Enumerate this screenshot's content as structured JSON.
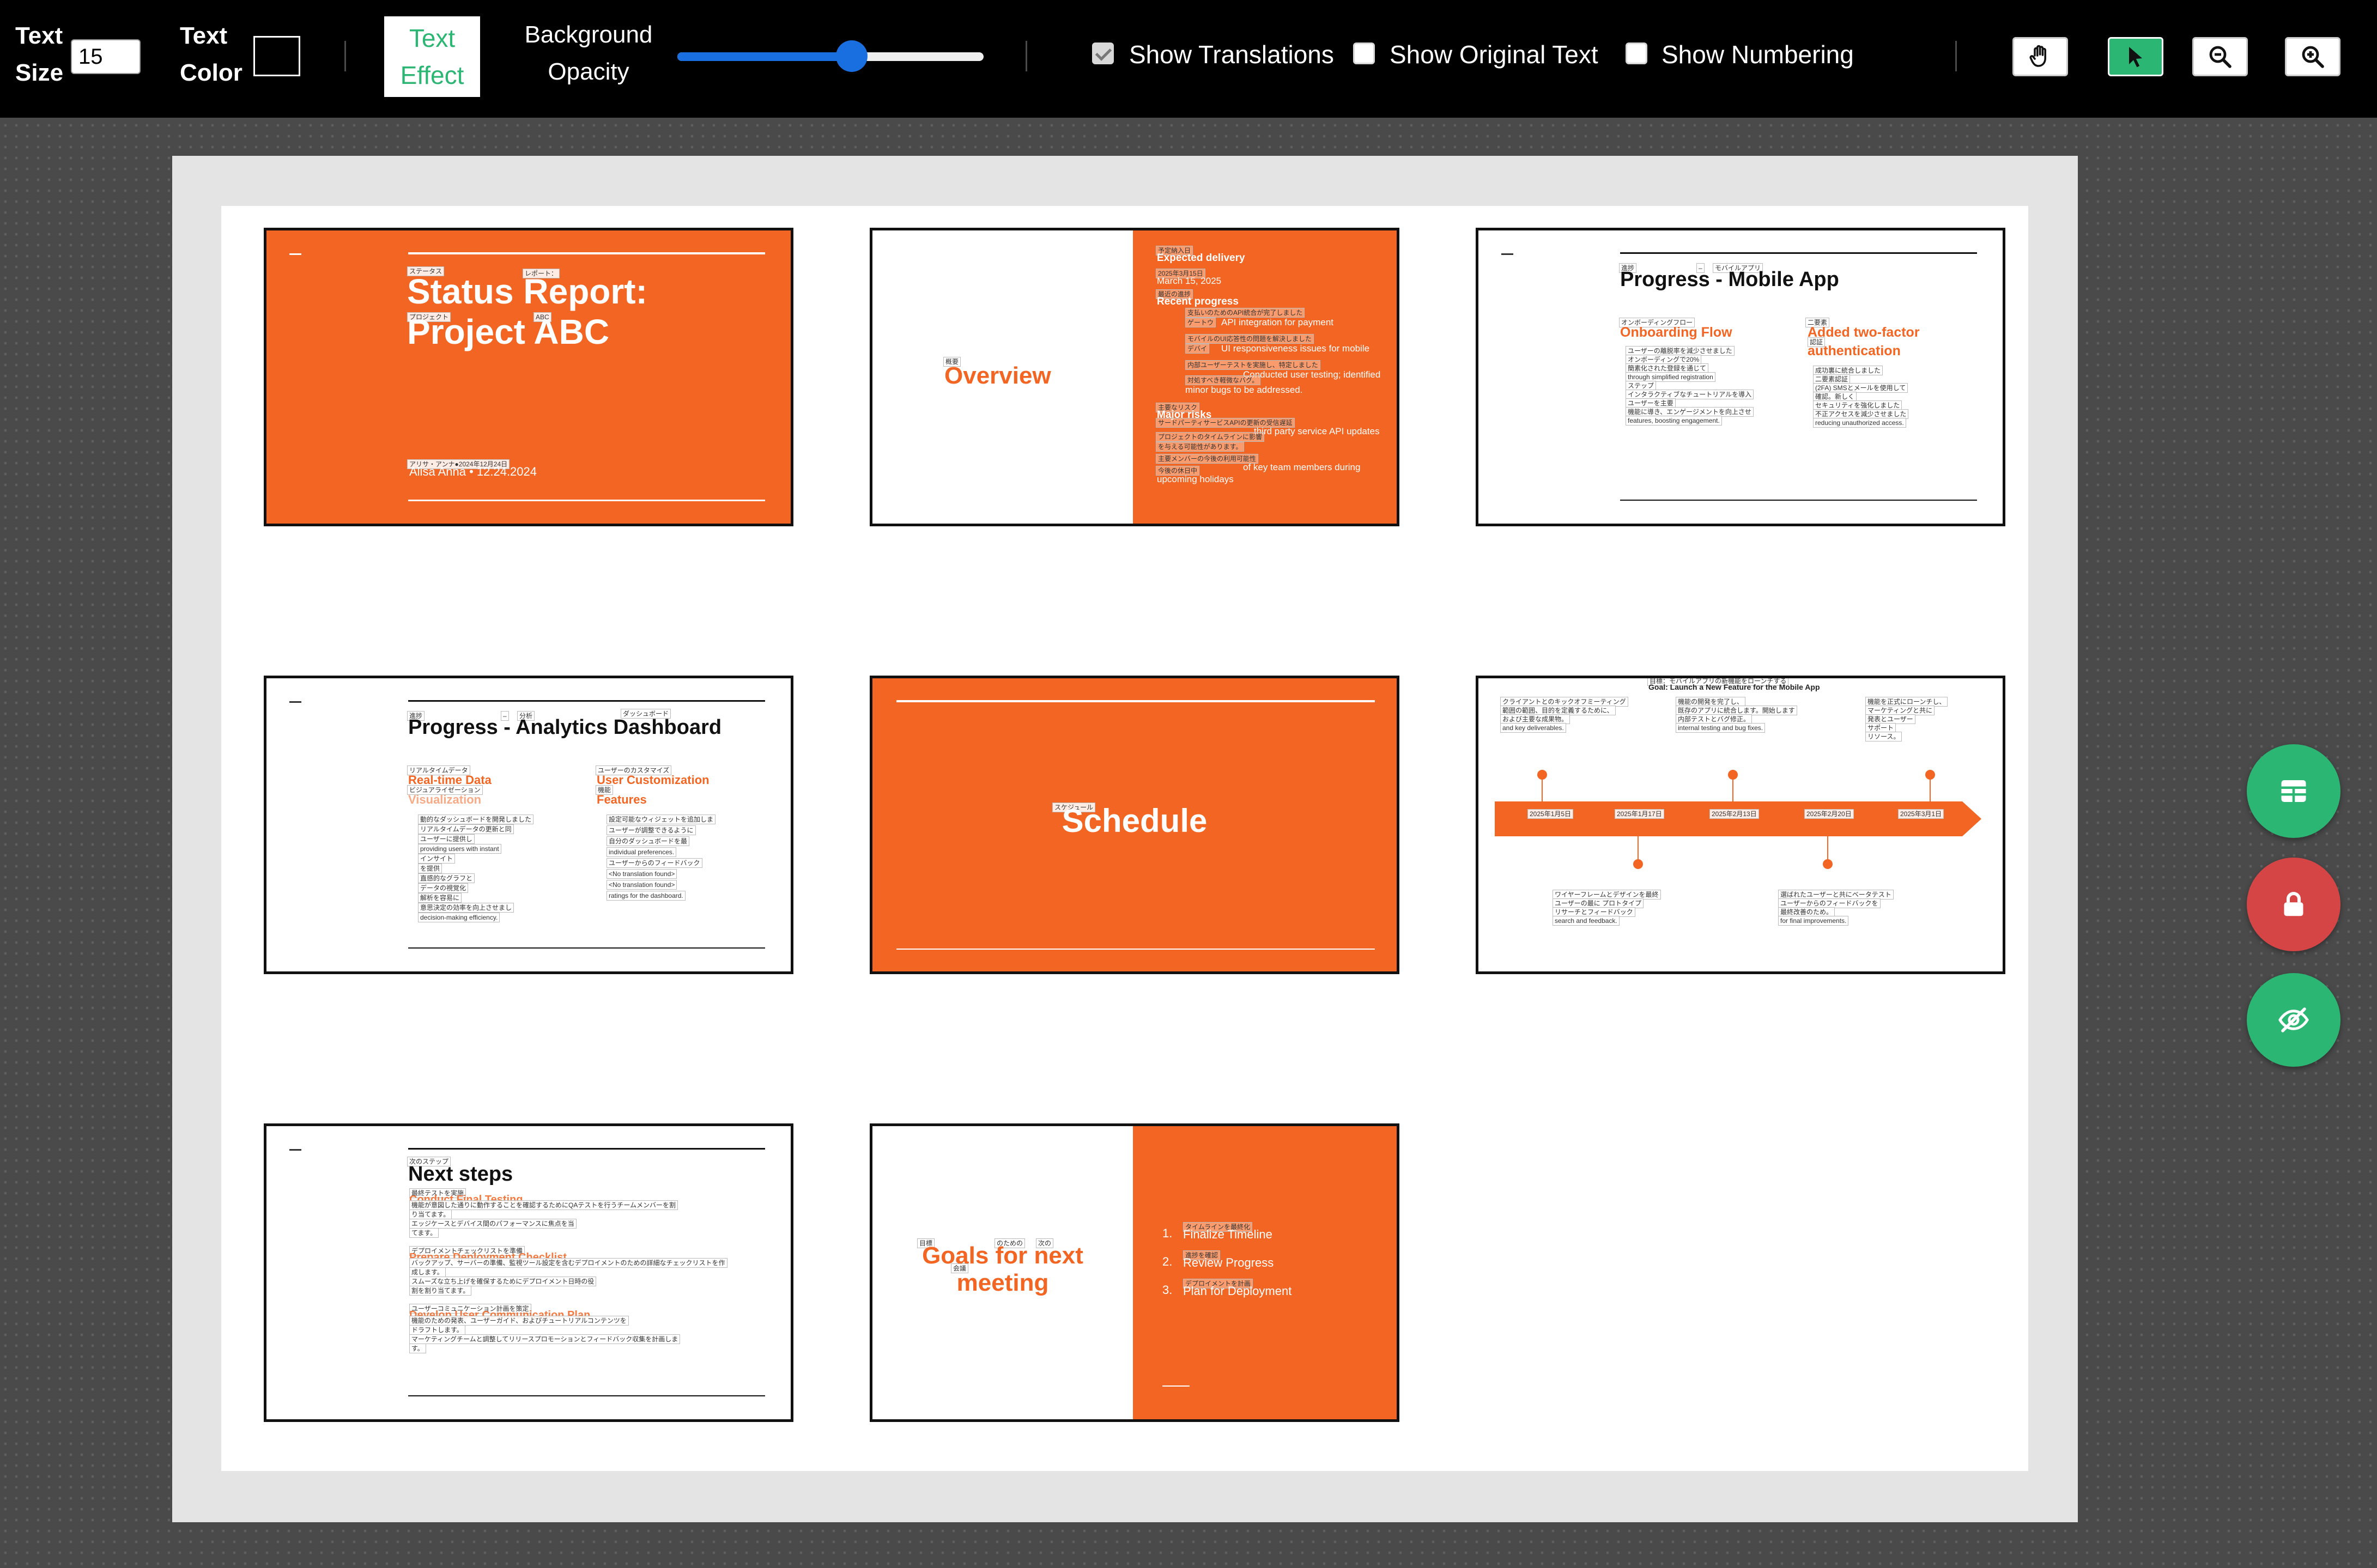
{
  "toolbar": {
    "text_size_label": [
      "Text",
      "Size"
    ],
    "text_size_value": "15",
    "text_color_label": [
      "Text",
      "Color"
    ],
    "text_color_value": "#000000",
    "text_effect_label": [
      "Text",
      "Effect"
    ],
    "background_opacity_label": [
      "Background",
      "Opacity"
    ],
    "background_opacity_value": 0.57,
    "show_translations": {
      "label": "Show Translations",
      "checked": true
    },
    "show_original_text": {
      "label": "Show Original Text",
      "checked": false
    },
    "show_numbering": {
      "label": "Show Numbering",
      "checked": false
    },
    "tools": [
      {
        "name": "hand-icon",
        "active": false
      },
      {
        "name": "cursor-icon",
        "active": true
      },
      {
        "name": "zoom-out-icon",
        "active": false
      },
      {
        "name": "zoom-in-icon",
        "active": false
      }
    ]
  },
  "colors": {
    "accent": "#f26522",
    "green": "#2bb673",
    "red": "#d64545"
  },
  "slides": {
    "s1": {
      "ann_status": "ステータス",
      "ann_report": "レポート：",
      "ann_project": "プロジェクト",
      "ann_abc": "ABC",
      "title1": "Status Report:",
      "title2": "Project ABC",
      "ann_footer": "アリサ・アンナ●2024年12月24日",
      "footer": "Alisa Anna • 12.24.2024"
    },
    "s2": {
      "ann_overview": "概要",
      "title": "Overview",
      "ann_expected": "予定納入日",
      "expected": "Expected delivery",
      "ann_date": "2025年3月15日",
      "date": "March 15, 2025",
      "ann_recent": "最近の進捗",
      "recent": "Recent progress",
      "bullets": [
        {
          "ann": "支払いのためのAPI統合が完了しました",
          "ann2": "ゲートウ",
          "text": "API integration for payment"
        },
        {
          "ann": "モバイルのUI応答性の問題を解決しました",
          "ann2": "デバイ",
          "text": "UI responsiveness issues for mobile"
        },
        {
          "ann": "内部ユーザーテストを実施し、特定しました",
          "ann2": "",
          "text": "Conducted user testing; identified"
        },
        {
          "ann": "対処すべき軽微なバグ。",
          "ann2": "",
          "text": "minor bugs to be addressed."
        }
      ],
      "ann_risks": "主要なリスク",
      "risks": "Major risks",
      "risk_lines": [
        {
          "ann": "サードパーティサービスAPIの更新の受信遅延",
          "text": "third party service API updates"
        },
        {
          "ann": "プロジェクトのタイムラインに影響",
          "text": ""
        },
        {
          "ann": "を与える可能性があります。",
          "text": ""
        },
        {
          "ann": "主要メンバーの今後の利用可能性",
          "text": "of key team members during"
        },
        {
          "ann": "今後の休日中",
          "text": "upcoming holidays"
        }
      ]
    },
    "s3": {
      "ann1": "進捗",
      "ann2": "–",
      "ann3": "モバイルアプリ",
      "title": "Progress - Mobile App",
      "col1_ann": "オンボーディングフロー",
      "col1_head": "Onboarding Flow",
      "col1_lines": [
        "ユーザーの離脱率を減少させました",
        "オンボーディングで20%",
        "簡素化された登録を通じて",
        "through simplified registration",
        "ステップ",
        "インタラクティブなチュートリアルを導入",
        "ユーザーを主要",
        "機能に導き、エンゲージメントを向上させ",
        "features, boosting engagement."
      ],
      "col2_ann1": "二要素",
      "col2_ann2": "認証",
      "col2_head1": "Added two-factor",
      "col2_head2": "authentication",
      "col2_lines": [
        "成功裏に統合しました",
        "二要素認証",
        "(2FA) SMSとメールを使用して",
        "確認。新しく",
        "セキュリティを強化しました",
        "不正アクセスを減少させました",
        "reducing unauthorized access."
      ]
    },
    "s4": {
      "ann1": "進捗",
      "ann2": "–",
      "ann3": "分析",
      "ann4": "ダッシュボード",
      "title": "Progress - Analytics Dashboard",
      "col1_ann1": "リアルタイムデータ",
      "col1_head1": "Real-time Data",
      "col1_ann2": "ビジュアライゼーション",
      "col1_head2": "Visualization",
      "col1_lines": [
        "動的なダッシュボードを開発しました",
        "リアルタイムデータの更新と同",
        "ユーザーに提供し",
        "providing users with instant",
        "インサイト",
        "を提供",
        "直感的なグラフと",
        "データの視覚化",
        "解析を容易に",
        "意思決定の効率を向上させまし",
        "decision-making efficiency."
      ],
      "col2_ann1": "ユーザーのカスタマイズ",
      "col2_head1": "User Customization",
      "col2_ann2": "機能",
      "col2_head2": "Features",
      "col2_lines": [
        "設定可能なウィジェットを追加しま",
        "ユーザーが調整できるように",
        "自分のダッシュボードを最",
        "individual preferences.",
        "ユーザーからのフィードバック",
        "<No translation found>",
        "<No translation found>",
        "ratings for the dashboard."
      ]
    },
    "s5": {
      "ann": "スケジュール",
      "title": "Schedule"
    },
    "s6": {
      "goal_ann": "目標：モバイルアプリの新機能をローンチする",
      "goal": "Goal: Launch a New Feature for the Mobile App",
      "top": [
        {
          "lines": [
            "クライアントとのキックオフミーティング",
            "範囲の範囲、目的を定義するために、",
            "および主要な成果物。",
            "and key deliverables."
          ]
        },
        {
          "lines": [
            "機能の開発を完了し、",
            "既存のアプリに統合します。開始します",
            "内部テストとバグ修正。",
            "internal testing and bug fixes."
          ]
        },
        {
          "lines": [
            "機能を正式にローンチし、",
            "マーケティングと共に",
            "発表とユーザー",
            "サポート",
            "リソース。"
          ]
        }
      ],
      "dates": [
        "2025年1月5日",
        "2025年1月17日",
        "2025年2月13日",
        "2025年2月20日",
        "2025年3月1日"
      ],
      "bottom": [
        {
          "lines": [
            "ワイヤーフレームとデザインを最終",
            "ユーザーの最に プロトタイプ",
            "リサーチとフィードバック",
            "search and feedback."
          ]
        },
        {
          "lines": [
            "選ばれたユーザーと共にベータテスト",
            "ユーザーからのフィードバックを",
            "最終改善のため。",
            "for final improvements."
          ]
        }
      ]
    },
    "s7": {
      "ann": "次のステップ",
      "title": "Next steps",
      "items": [
        {
          "ann_head": "最終テストを実施",
          "head": "Conduct Final Testing",
          "lines": [
            "機能が意図した通りに動作することを確認するためにQAテストを行うチームメンバーを割",
            "り当てます。",
            "エッジケースとデバイス間のパフォーマンスに焦点を当",
            "てます。"
          ]
        },
        {
          "ann_head": "デプロイメントチェックリストを準備",
          "head": "Prepare Deployment Checklist",
          "lines": [
            "バックアップ、サーバーの準備、監視ツール設定を含むデプロイメントのための詳細なチェックリストを作",
            "成します。",
            "スムーズな立ち上げを確保するためにデプロイメント日時の役",
            "割を割り当てます。"
          ]
        },
        {
          "ann_head": "ユーザーコミュニケーション計画を策定",
          "head": "Develop User Communication Plan",
          "lines": [
            "機能のための発表、ユーザーガイド、およびチュートリアルコンテンツを",
            "ドラフトします。",
            "マーケティングチームと調整してリリースプロモーションとフィードバック収集を計画しま",
            "す。"
          ]
        }
      ]
    },
    "s8": {
      "ann1": "目標",
      "ann2": "のための",
      "ann3": "次の",
      "ann4": "会議",
      "title1": "Goals for next",
      "title2": "meeting",
      "items": [
        {
          "num": "1.",
          "ann": "タイムラインを最終化",
          "text": "Finalize Timeline"
        },
        {
          "num": "2.",
          "ann": "進捗を確認",
          "text": "Review Progress"
        },
        {
          "num": "3.",
          "ann": "デプロイメントを計画",
          "text": "Plan for Deployment"
        }
      ]
    }
  },
  "fabs": [
    {
      "name": "table-icon",
      "color": "#2bb673"
    },
    {
      "name": "lock-icon",
      "color": "#d64545"
    },
    {
      "name": "eye-off-icon",
      "color": "#2bb673"
    }
  ]
}
